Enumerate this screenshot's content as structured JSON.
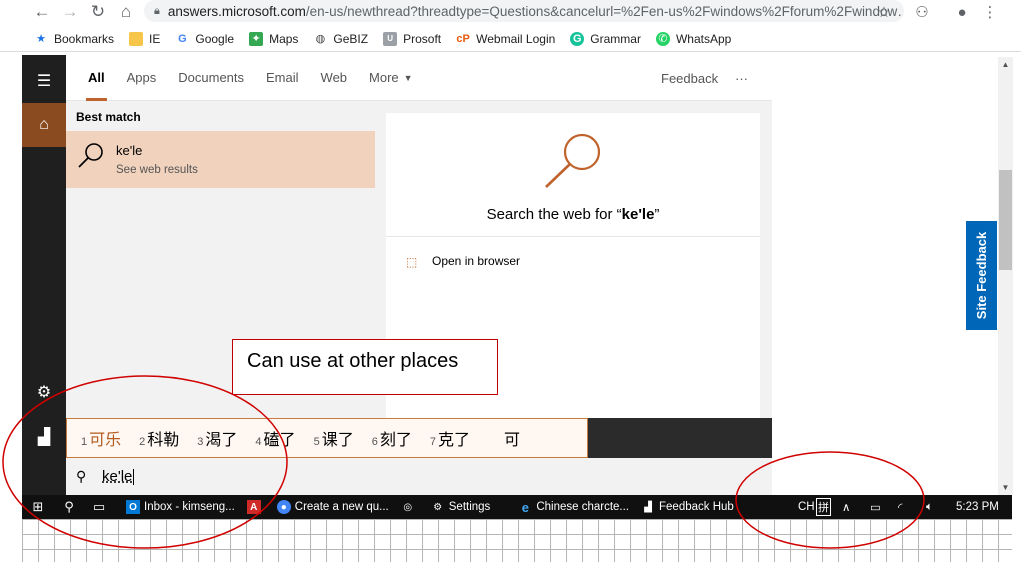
{
  "browser": {
    "url_host": "answers.microsoft.com",
    "url_path": "/en-us/newthread?threadtype=Questions&cancelurl=%2Fen-us%2Fwindows%2Fforum%2Fwindow…",
    "bookmarks": [
      {
        "label": "Bookmarks"
      },
      {
        "label": "IE"
      },
      {
        "label": "Google"
      },
      {
        "label": "Maps"
      },
      {
        "label": "GeBIZ"
      },
      {
        "label": "Prosoft"
      },
      {
        "label": "Webmail Login"
      },
      {
        "label": "Grammar"
      },
      {
        "label": "WhatsApp"
      }
    ]
  },
  "page": {
    "site_feedback_label": "Site Feedback"
  },
  "search": {
    "tabs": [
      {
        "label": "All"
      },
      {
        "label": "Apps"
      },
      {
        "label": "Documents"
      },
      {
        "label": "Email"
      },
      {
        "label": "Web"
      },
      {
        "label": "More"
      }
    ],
    "feedback_label": "Feedback",
    "more_options": "···",
    "best_match_title": "Best match",
    "best_match_query": "ke'le",
    "best_match_sub": "See web results",
    "preview_title_prefix": "Search the web for “",
    "preview_title_query": "ke'le",
    "preview_title_suffix": "”",
    "open_browser_label": "Open in browser",
    "input_value": "ke'le"
  },
  "ime": {
    "candidates": [
      {
        "n": "1",
        "w": "可乐"
      },
      {
        "n": "2",
        "w": "科勒"
      },
      {
        "n": "3",
        "w": "渴了"
      },
      {
        "n": "4",
        "w": "磕了"
      },
      {
        "n": "5",
        "w": "课了"
      },
      {
        "n": "6",
        "w": "刻了"
      },
      {
        "n": "7",
        "w": "克了"
      },
      {
        "n": "",
        "w": "可"
      }
    ]
  },
  "annotation": {
    "text": "Can use at other places"
  },
  "taskbar": {
    "apps": [
      {
        "label": "Inbox - kimseng..."
      },
      {
        "label": "Create a new qu..."
      },
      {
        "label": "Settings"
      },
      {
        "label": "Chinese charcte..."
      },
      {
        "label": "Feedback Hub"
      }
    ],
    "lang": "CH",
    "ime_mode": "拼",
    "time": "5:23 PM"
  },
  "colors": {
    "accent": "#c0622b",
    "best_match_bg": "#f0d2bd",
    "annotation_red": "#c00000",
    "site_feedback_blue": "#0067b8"
  }
}
